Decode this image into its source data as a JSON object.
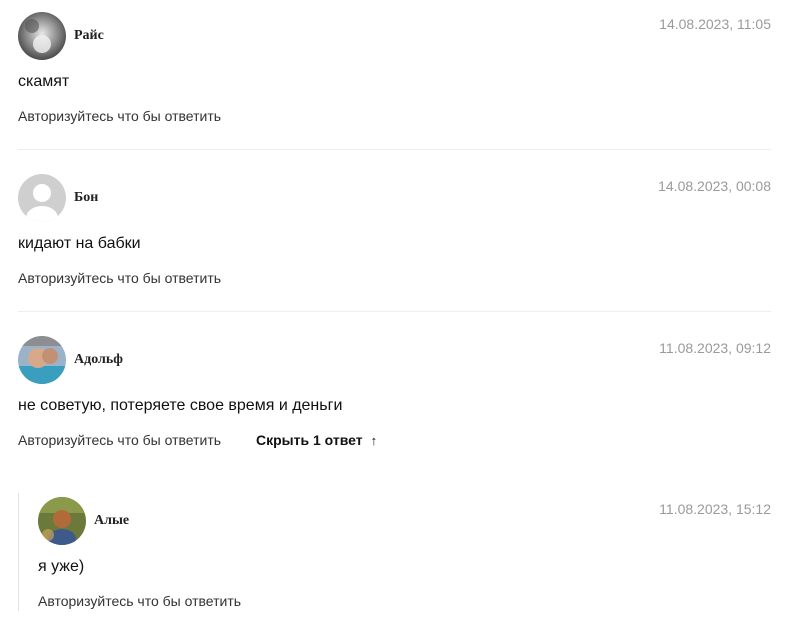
{
  "comments": [
    {
      "author": "Райс",
      "date": "14.08.2023, 11:05",
      "text": "скамят",
      "reply_label": "Авторизуйтесь что бы ответить",
      "avatar_icon": "user-photo-grayscale-icon"
    },
    {
      "author": "Бон",
      "date": "14.08.2023, 00:08",
      "text": "кидают на бабки",
      "reply_label": "Авторизуйтесь что бы ответить",
      "avatar_icon": "default-user-icon"
    },
    {
      "author": "Адольф",
      "date": "11.08.2023, 09:12",
      "text": "не советую, потеряете свое время и деньги",
      "reply_label": "Авторизуйтесь что бы ответить",
      "hide_replies_label": "Скрыть 1 ответ",
      "hide_replies_arrow": "↑",
      "avatar_icon": "user-photo-icon",
      "replies": [
        {
          "author": "Алые",
          "date": "11.08.2023, 15:12",
          "text": "я уже)",
          "reply_label": "Авторизуйтесь что бы ответить",
          "avatar_icon": "user-photo-icon"
        }
      ]
    }
  ],
  "colors": {
    "date": "#9a9a9a",
    "separator": "#eeeeee",
    "default_avatar_bg": "#cfcfcf"
  }
}
